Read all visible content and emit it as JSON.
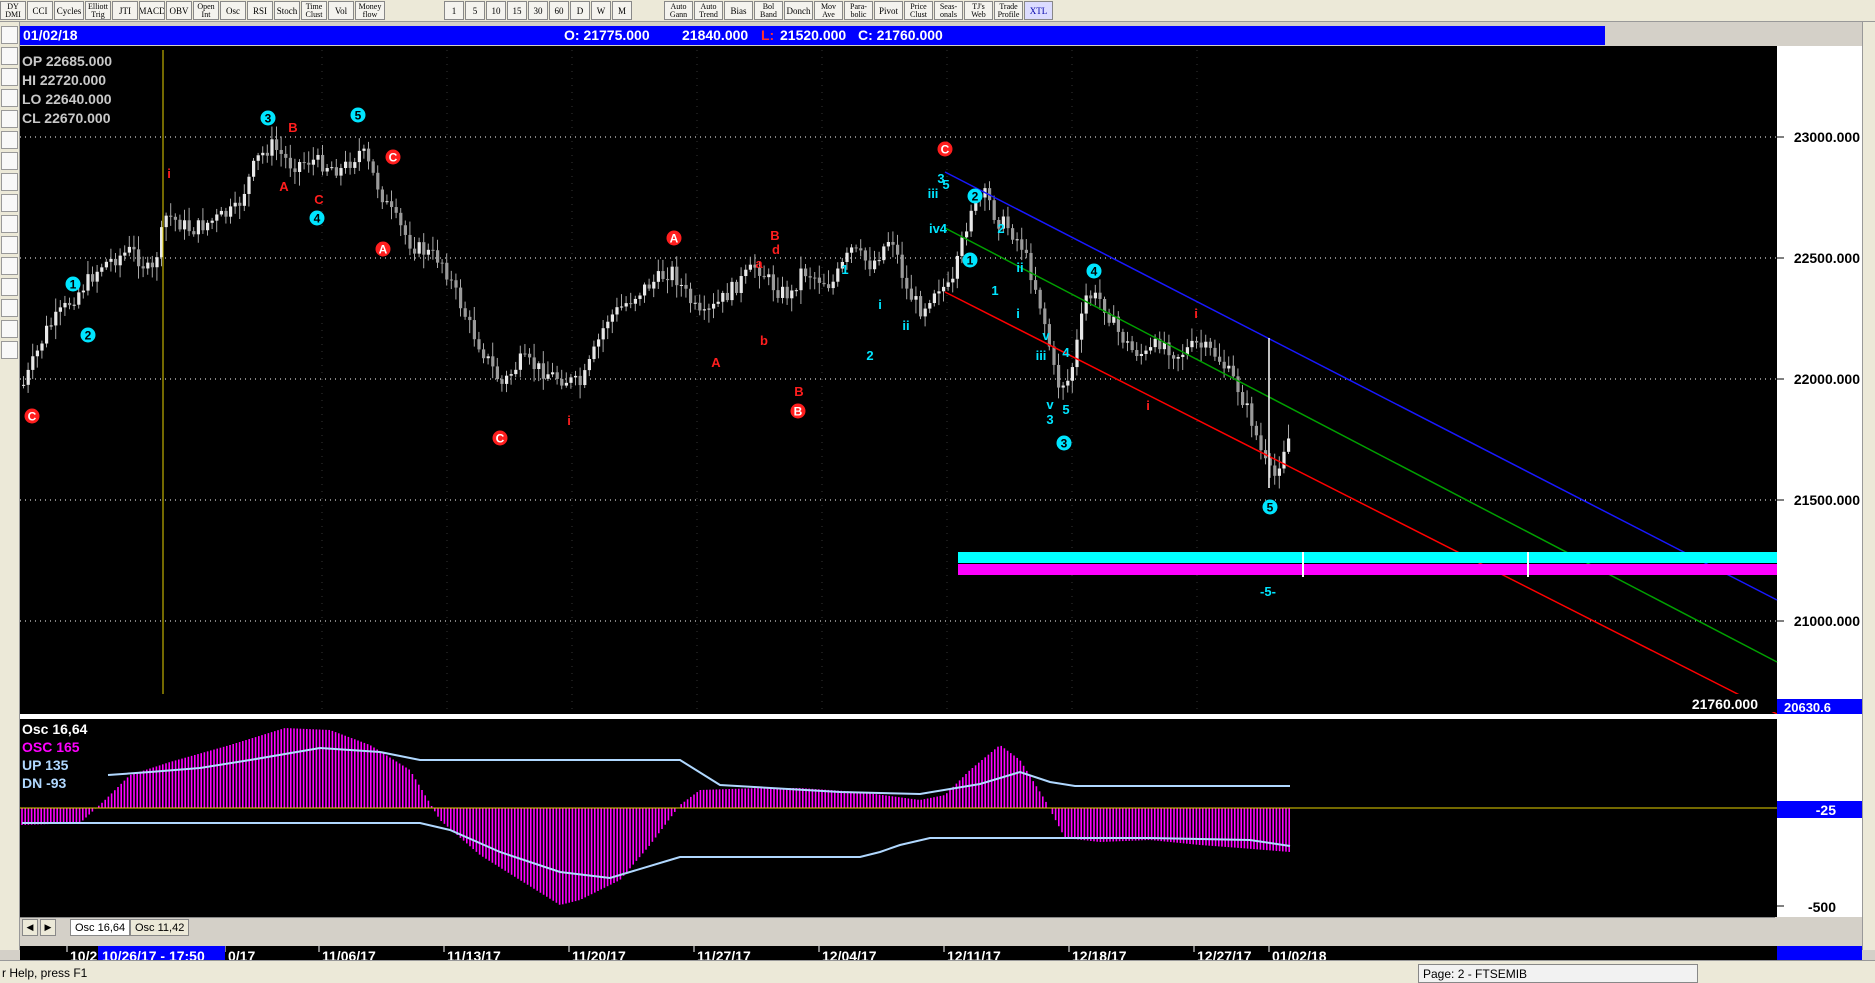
{
  "toolbar": {
    "groups": [
      [
        "DY\nDMI",
        "CCI",
        "Cycles",
        "Elliott\nTrig",
        "JTI",
        "MACD",
        "OBV",
        "Open\nInt",
        "Osc",
        "RSI",
        "Stoch",
        "Time\nClust",
        "Vol",
        "Money\nflow"
      ],
      [
        "1",
        "5",
        "10",
        "15",
        "30",
        "60",
        "D",
        "W",
        "M"
      ],
      [
        "Auto\nGann",
        "Auto\nTrend",
        "Bias",
        "Bol\nBand",
        "Donch",
        "Mov\nAve",
        "Para-\nbolic",
        "Pivot",
        "Price\nClust",
        "Seas-\nonals",
        "TJ's\nWeb",
        "Trade\nProfile",
        "XTL"
      ]
    ]
  },
  "header": {
    "date": "01/02/18",
    "open": "O: 21775.000",
    "high": "21840.000",
    "low_prefix": "L:",
    "low": "21520.000",
    "close": "C: 21760.000"
  },
  "info_box": {
    "op": "OP  22685.000",
    "hi": "HI   22720.000",
    "lo": "LO  22640.000",
    "cl": "CL  22670.000"
  },
  "price_axis": {
    "ticks": [
      "23000.000",
      "22500.000",
      "22000.000",
      "21500.000",
      "21000.000"
    ],
    "last_price": "21760.000",
    "bottom_price": "20630.6"
  },
  "oscillator": {
    "title": "Osc 16,64",
    "osc": "OSC  165",
    "up": "UP    135",
    "dn": "DN    -93",
    "axis_ticks": [
      "-25",
      "-500"
    ]
  },
  "date_axis": {
    "labels": [
      "10/2",
      "0/17",
      "11/06/17",
      "11/13/17",
      "11/20/17",
      "11/27/17",
      "12/04/17",
      "12/11/17",
      "12/18/17",
      "12/27/17",
      "01/02/18"
    ],
    "cursor": "10/26/17 - 17:50"
  },
  "tabs": {
    "items": [
      "Osc 16,64",
      "Osc 11,42"
    ]
  },
  "status": {
    "help": "r Help, press F1",
    "page": "Page: 2 - FTSEMIB"
  },
  "annotations": {
    "minus5": "-5-"
  },
  "colors": {
    "title_blue": "#0000ff",
    "chart_bg": "#000000",
    "candle": "#c8c8c8",
    "wave_cyan": "#00e5ff",
    "wave_red": "#ff1e1e",
    "osc_magenta": "#ff00ff",
    "band_light": "#b0d8ff",
    "zone_cyan": "#00ffff",
    "zone_magenta": "#ff00ff",
    "channel_blue": "#1818ff",
    "channel_green": "#00a000",
    "channel_red": "#ff0000",
    "cursor_yellow": "#e6d200"
  }
}
